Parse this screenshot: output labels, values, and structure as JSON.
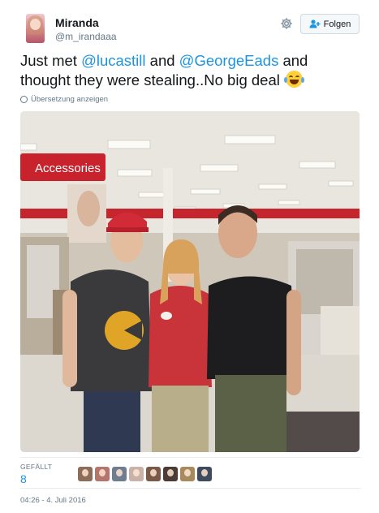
{
  "user": {
    "name": "Miranda",
    "handle": "@m_irandaaa"
  },
  "follow_button": {
    "label": "Folgen"
  },
  "tweet": {
    "text_parts": {
      "part1": "Just met ",
      "mention1": "@lucastill",
      "part2": " and ",
      "mention2": "@GeorgeEads",
      "part3": " and thought they were stealing..No big deal"
    },
    "emoji": "face-with-tears-of-joy",
    "translate_label": "Übersetzung anzeigen"
  },
  "photo": {
    "store_sign": "Accessories"
  },
  "stats": {
    "likes_label": "GEFÄLLT",
    "likes_count": "8",
    "liker_colors": [
      "#8c6d5a",
      "#b5756d",
      "#6f7d8f",
      "#c9b3a8",
      "#7a5a46",
      "#4b3b34",
      "#a88a5f",
      "#3e4a5e"
    ]
  },
  "timestamp": "04:26 - 4. Juli 2016",
  "icons": {
    "settings": "gear-icon",
    "follow": "add-user-icon",
    "translate": "globe-icon"
  }
}
